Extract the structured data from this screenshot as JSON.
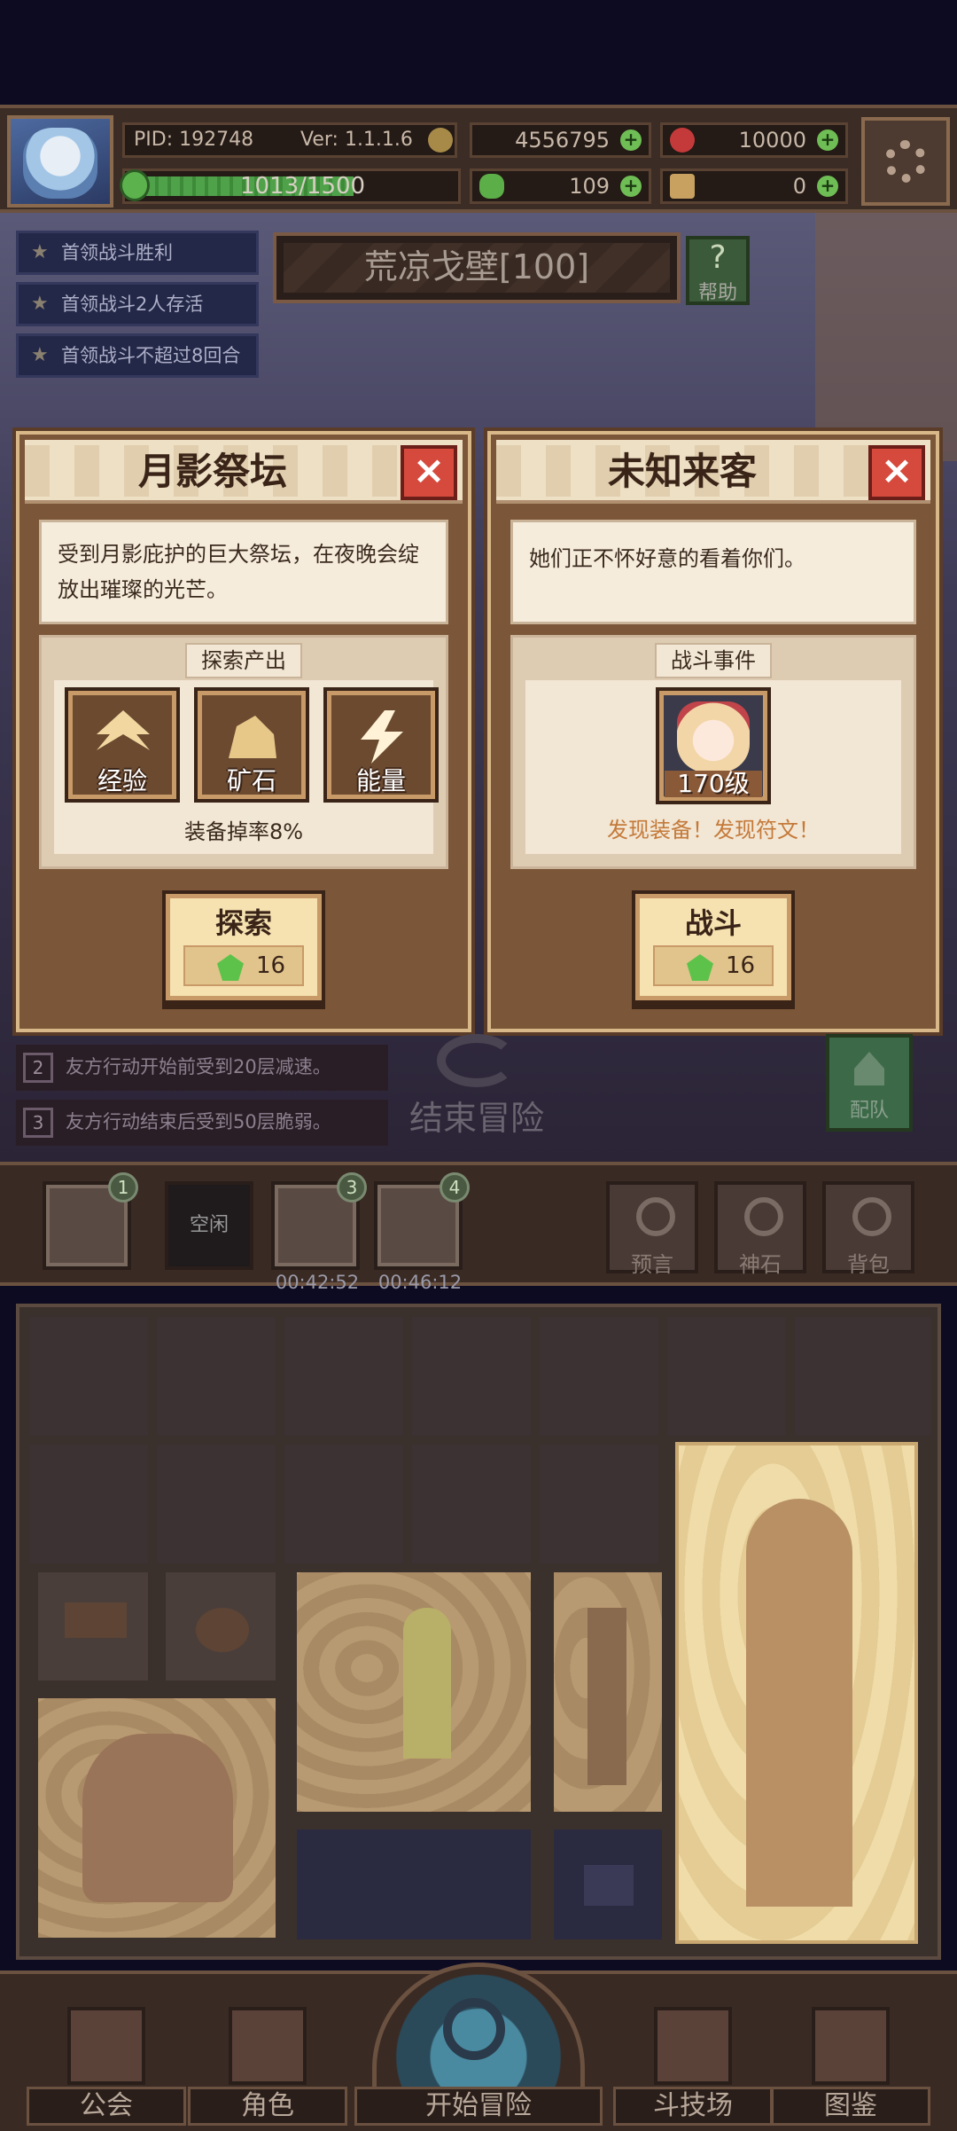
{
  "hud": {
    "pid": "PID: 192748",
    "version": "Ver: 1.1.1.6",
    "gold": "4556795",
    "gems": "10000",
    "xp_text": "1013/1500",
    "xp_progress": 0.675,
    "clover": "109",
    "keys": "0",
    "plus": "+"
  },
  "quests": [
    "首领战斗胜利",
    "首领战斗2人存活",
    "首领战斗不超过8回合"
  ],
  "area": {
    "title": "荒凉戈壁[100]",
    "help_label": "帮助",
    "help_symbol": "?"
  },
  "card_left": {
    "title": "月影祭坛",
    "close": "×",
    "description": "受到月影庇护的巨大祭坛，在夜晚会绽放出璀璨的光芒。",
    "section_label": "探索产出",
    "products": [
      "经验",
      "矿石",
      "能量"
    ],
    "drop_rate": "装备掉率8%",
    "button_label": "探索",
    "cost": "16"
  },
  "card_right": {
    "title": "未知来客",
    "close": "×",
    "description": "她们正不怀好意的看着你们。",
    "section_label": "战斗事件",
    "enemy_level": "170级",
    "discover": "发现装备！发现符文！",
    "button_label": "战斗",
    "cost": "16"
  },
  "rules": [
    {
      "num": "2",
      "text": "友方行动开始前受到20层减速。"
    },
    {
      "num": "3",
      "text": "友方行动结束后受到50层脆弱。"
    }
  ],
  "end_adventure": "结束冒险",
  "team": "配队",
  "slots": {
    "slot1_badge": "1",
    "idle": "空闲",
    "slot3_badge": "3",
    "slot3_timer": "00:42:52",
    "slot4_badge": "4",
    "slot4_timer": "00:46:12"
  },
  "menu": [
    "预言",
    "神石",
    "背包"
  ],
  "nav": [
    "公会",
    "角色",
    "开始冒险",
    "斗技场",
    "图鉴"
  ],
  "colors": {
    "accent_gold": "#d8b888",
    "close_red": "#d64a3e",
    "gem_green": "#5dc24a",
    "discover_orange": "#c47a3a"
  }
}
